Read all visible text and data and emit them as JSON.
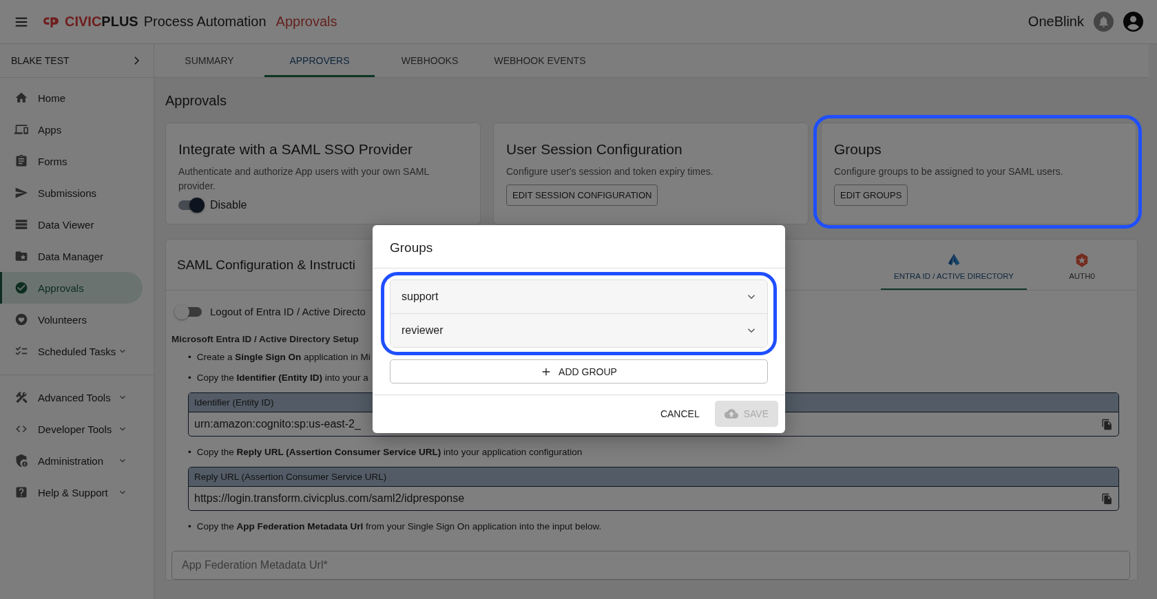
{
  "header": {
    "brand": {
      "mark_red": "CIVIC",
      "mark_dark": "PLUS",
      "product": "Process Automation",
      "section": "Approvals"
    },
    "account": "OneBlink"
  },
  "sidebar": {
    "account": "BLAKE TEST",
    "groups": [
      [
        {
          "label": "Home",
          "selected": false,
          "expandable": false
        },
        {
          "label": "Apps",
          "selected": false,
          "expandable": false
        },
        {
          "label": "Forms",
          "selected": false,
          "expandable": false
        },
        {
          "label": "Submissions",
          "selected": false,
          "expandable": false
        },
        {
          "label": "Data Viewer",
          "selected": false,
          "expandable": false
        },
        {
          "label": "Data Manager",
          "selected": false,
          "expandable": false
        },
        {
          "label": "Approvals",
          "selected": true,
          "expandable": false
        },
        {
          "label": "Volunteers",
          "selected": false,
          "expandable": false
        },
        {
          "label": "Scheduled Tasks",
          "selected": false,
          "expandable": true
        }
      ],
      [
        {
          "label": "Advanced Tools",
          "selected": false,
          "expandable": true
        },
        {
          "label": "Developer Tools",
          "selected": false,
          "expandable": true
        },
        {
          "label": "Administration",
          "selected": false,
          "expandable": true
        },
        {
          "label": "Help & Support",
          "selected": false,
          "expandable": true
        }
      ]
    ]
  },
  "tabs": [
    {
      "label": "SUMMARY",
      "selected": false
    },
    {
      "label": "APPROVERS",
      "selected": true
    },
    {
      "label": "WEBHOOKS",
      "selected": false
    },
    {
      "label": "WEBHOOK EVENTS",
      "selected": false
    }
  ],
  "page_title": "Approvals",
  "cards": [
    {
      "kind": "toggle",
      "title": "Integrate with a SAML SSO Provider",
      "description": "Authenticate and authorize App users with your own SAML provider.",
      "toggle": {
        "label": "Disable",
        "on": true
      },
      "highlighted": false
    },
    {
      "kind": "button",
      "title": "User Session Configuration",
      "description": "Configure user's session and token expiry times.",
      "button": "EDIT SESSION CONFIGURATION",
      "highlighted": false
    },
    {
      "kind": "button",
      "title": "Groups",
      "description": "Configure groups to be assigned to your SAML users.",
      "button": "EDIT GROUPS",
      "highlighted": true
    }
  ],
  "saml": {
    "title": "SAML Configuration & Instructi",
    "tabs": [
      {
        "label": "ENTRA ID / ACTIVE DIRECTORY",
        "selected": true
      },
      {
        "label": "AUTH0",
        "selected": false
      }
    ],
    "logout_toggle": {
      "label": "Logout of Entra ID / Active Directo",
      "on": false
    },
    "setup_heading": "Microsoft Entra ID / Active Directory Setup",
    "steps": [
      {
        "bullet": "•",
        "text": "Create a **Single Sign On** application in Mi"
      },
      {
        "bullet": "•",
        "text": "Copy the **Identifier (Entity ID)** into your a",
        "copy_box": {
          "label": "Identifier (Entity ID)",
          "value": "urn:amazon:cognito:sp:us-east-2_"
        }
      },
      {
        "bullet": "•",
        "text": "Copy the **Reply URL (Assertion Consumer Service URL)** into your application configuration",
        "copy_box": {
          "label": "Reply URL (Assertion Consumer Service URL)",
          "value": "https://login.transform.civicplus.com/saml2/idpresponse"
        }
      },
      {
        "bullet": "•",
        "text": "Copy the **App Federation Metadata Url** from your Single Sign On application into the input below."
      }
    ],
    "metadata_input": {
      "placeholder": "App Federation Metadata Url*"
    }
  },
  "dialog": {
    "title": "Groups",
    "groups_highlighted": true,
    "groups": [
      {
        "name": "support",
        "expanded": false
      },
      {
        "name": "reviewer",
        "expanded": false
      }
    ],
    "add_button": "ADD GROUP",
    "cancel": "CANCEL",
    "save": {
      "label": "SAVE",
      "disabled": true
    }
  }
}
